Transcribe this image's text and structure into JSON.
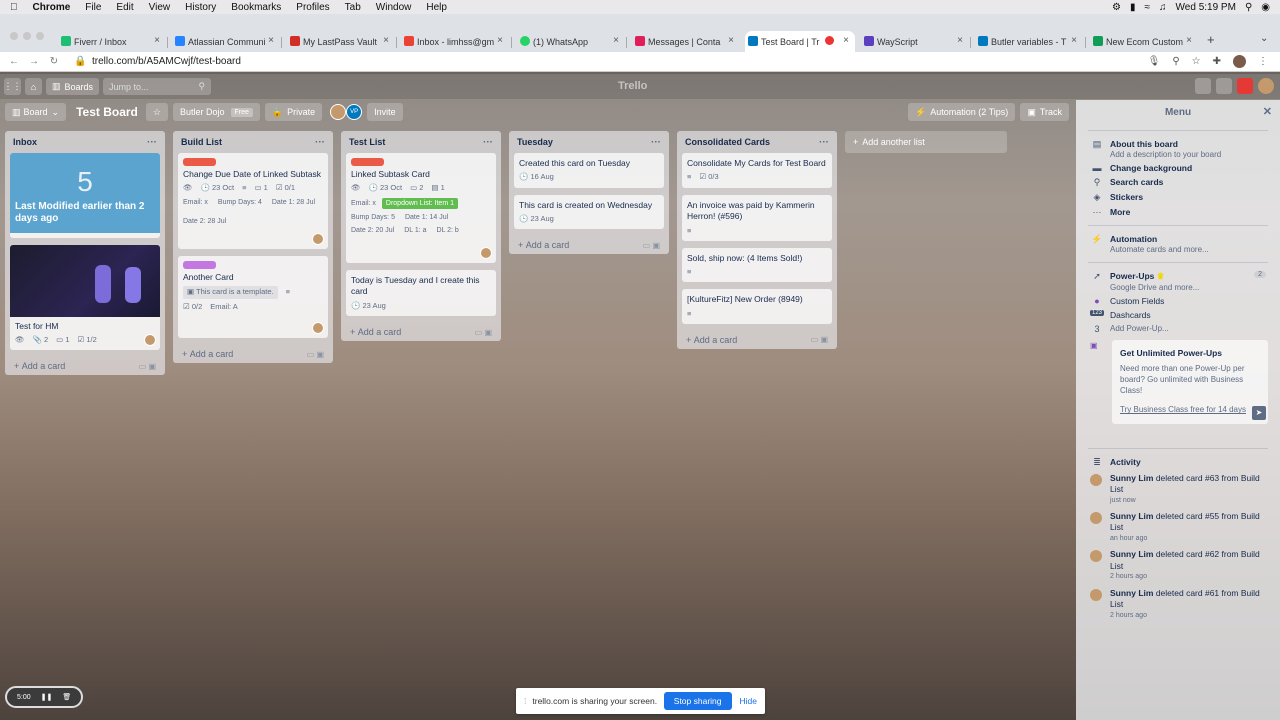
{
  "macbar": {
    "app": "Chrome",
    "menus": [
      "File",
      "Edit",
      "View",
      "History",
      "Bookmarks",
      "Profiles",
      "Tab",
      "Window",
      "Help"
    ],
    "clock": "Wed 5:19 PM"
  },
  "tabs": [
    {
      "title": "Fiverr / Inbox",
      "color": "#1dbf73"
    },
    {
      "title": "Atlassian Communi",
      "color": "#2684ff"
    },
    {
      "title": "My LastPass Vault",
      "color": "#d32d27"
    },
    {
      "title": "Inbox - limhss@gm",
      "color": "#ea4335"
    },
    {
      "title": "(1) WhatsApp",
      "color": "#25d366"
    },
    {
      "title": "Messages | Conta",
      "color": "#e01e5a"
    },
    {
      "title": "Test Board | Tr",
      "color": "#e44"
    },
    {
      "title": "WayScript",
      "color": "#5a3fc0"
    },
    {
      "title": "Butler variables - T",
      "color": "#0079bf"
    },
    {
      "title": "New Ecom Custom",
      "color": "#0f9d58"
    }
  ],
  "address": {
    "url": "trello.com/b/A5AMCwjf/test-board"
  },
  "trello": {
    "boards_label": "Boards",
    "search_placeholder": "Jump to...",
    "logo": "Trello"
  },
  "board": {
    "view": "Board",
    "title": "Test Board",
    "team": "Butler Dojo",
    "team_badge": "Free",
    "visibility": "Private",
    "member_initials": "VP",
    "invite": "Invite",
    "automation": "Automation (2 Tips)",
    "track": "Track"
  },
  "lists": [
    {
      "title": "Inbox",
      "cards": [
        {
          "badge_number": "5",
          "badge_text": "Last Modified earlier than 2 days ago"
        },
        {
          "title": "Test for HM",
          "attachments": "2",
          "comments": "1",
          "checklist": "1/2"
        }
      ],
      "add": "Add a card"
    },
    {
      "title": "Build List",
      "cards": [
        {
          "label_color": "#eb5a46",
          "title": "Change Due Date of Linked Subtask",
          "due": "23 Oct",
          "comments": "1",
          "checklist": "0/1",
          "fields": [
            "Email: x",
            "Bump Days: 4",
            "Date 1: 28 Jul",
            "Date 2: 28 Jul"
          ]
        },
        {
          "label_color": "#c377e0",
          "title": "Another Card",
          "template": "This card is a template.",
          "checklist": "0/2",
          "email": "Email: A"
        }
      ],
      "add": "Add a card"
    },
    {
      "title": "Test List",
      "cards": [
        {
          "label_color": "#eb5a46",
          "title": "Linked Subtask Card",
          "due": "23 Oct",
          "comments": "2",
          "attachments": "1",
          "email": "Email: x",
          "dropdown": "Dropdown List: Item 1",
          "fields": [
            "Bump Days: 5",
            "Date 1: 14 Jul",
            "Date 2: 20 Jul",
            "DL 1: a",
            "DL 2: b"
          ]
        },
        {
          "title": "Today is Tuesday and I create this card",
          "due": "23 Aug"
        }
      ],
      "add": "Add a card"
    },
    {
      "title": "Tuesday",
      "cards": [
        {
          "title": "Created this card on Tuesday",
          "due": "16 Aug"
        },
        {
          "title": "This card is created on Wednesday",
          "due": "23 Aug"
        }
      ],
      "add": "Add a card"
    },
    {
      "title": "Consolidated Cards",
      "cards": [
        {
          "title": "Consolidate My Cards for Test Board",
          "checklist": "0/3"
        },
        {
          "title": "An invoice was paid by Kammerin Herron! (#596)"
        },
        {
          "title": "Sold, ship now: (4 Items Sold!)"
        },
        {
          "title": "[KultureFitz] New Order (8949)"
        }
      ],
      "add": "Add a card"
    }
  ],
  "add_list": "Add another list",
  "menu": {
    "title": "Menu",
    "about_title": "About this board",
    "about_sub": "Add a description to your board",
    "change_bg": "Change background",
    "search": "Search cards",
    "stickers": "Stickers",
    "more": "More",
    "automation_title": "Automation",
    "automation_sub": "Automate cards and more...",
    "powerups_title": "Power-Ups",
    "powerups_count": "2",
    "powerups_sub": "Google Drive and more...",
    "custom_fields": "Custom Fields",
    "dashcards": "Dashcards",
    "dashcards_icon": "123",
    "add_powerup_num": "3",
    "add_powerup": "Add Power-Up...",
    "promo_title": "Get Unlimited Power-Ups",
    "promo_body": "Need more than one Power-Up per board? Go unlimited with Business Class!",
    "promo_link": "Try Business Class free for 14 days",
    "activity_title": "Activity",
    "activity": [
      {
        "user": "Sunny Lim",
        "text": "deleted card #63 from Build List",
        "time": "just now"
      },
      {
        "user": "Sunny Lim",
        "text": "deleted card #55 from Build List",
        "time": "an hour ago"
      },
      {
        "user": "Sunny Lim",
        "text": "deleted card #62 from Build List",
        "time": "2 hours ago"
      },
      {
        "user": "Sunny Lim",
        "text": "deleted card #61 from Build List",
        "time": "2 hours ago"
      }
    ]
  },
  "share": {
    "text": "trello.com is sharing your screen.",
    "stop": "Stop sharing",
    "hide": "Hide"
  },
  "recorder": {
    "time": "5:00"
  }
}
